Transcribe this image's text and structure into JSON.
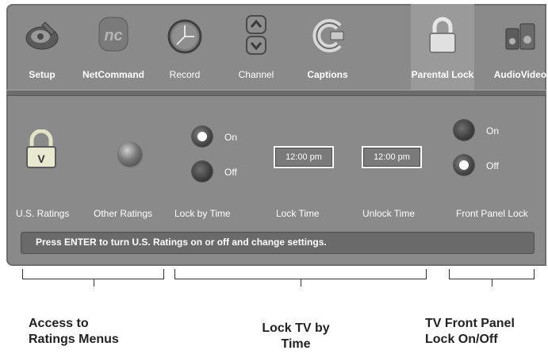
{
  "tabs": [
    {
      "label": "Setup",
      "icon": "setup-icon"
    },
    {
      "label": "NetCommand",
      "icon": "netcommand-icon"
    },
    {
      "label": "Record",
      "icon": "record-icon"
    },
    {
      "label": "Channel",
      "icon": "channel-icon"
    },
    {
      "label": "Captions",
      "icon": "captions-icon"
    },
    {
      "label": "Parental Lock",
      "icon": "padlock-icon",
      "selected": true
    },
    {
      "label": "AudioVideo",
      "icon": "audio-video-icon"
    }
  ],
  "controls": {
    "us_ratings": {
      "label": "U.S. Ratings"
    },
    "other_ratings": {
      "label": "Other Ratings"
    },
    "lock_by_time": {
      "label": "Lock by Time",
      "on": "On",
      "off": "Off",
      "selected": "On"
    },
    "lock_time": {
      "label": "Lock Time",
      "value": "12:00 pm"
    },
    "unlock_time": {
      "label": "Unlock Time",
      "value": "12:00 pm"
    },
    "front_panel_lock": {
      "label": "Front Panel Lock",
      "on": "On",
      "off": "Off",
      "selected": "Off"
    }
  },
  "status": "Press ENTER to turn U.S. Ratings on or off and change settings.",
  "annotations": [
    "Access to\nRatings Menus",
    "Lock TV by\nTime",
    "TV Front Panel\nLock On/Off"
  ],
  "colors": {
    "panel": "#8a8a8a",
    "text": "#ffffff",
    "caption": "#222222"
  }
}
